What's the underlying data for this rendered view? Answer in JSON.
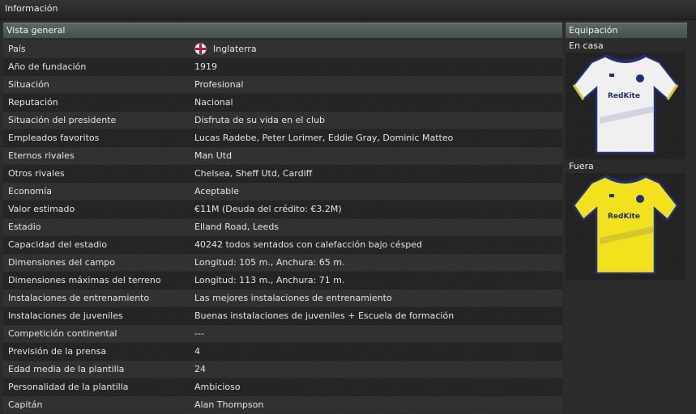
{
  "window": {
    "title": "Información"
  },
  "overview": {
    "header": "Vista general",
    "rows": [
      {
        "label": "País",
        "value": "Inglaterra"
      },
      {
        "label": "Año de fundación",
        "value": "1919"
      },
      {
        "label": "Situación",
        "value": "Profesional"
      },
      {
        "label": "Reputación",
        "value": "Nacional"
      },
      {
        "label": "Situación del presidente",
        "value": "Disfruta de su vida en el club"
      },
      {
        "label": "Empleados favoritos",
        "value": "Lucas Radebe, Peter Lorimer, Eddie Gray, Dominic Matteo"
      },
      {
        "label": "Eternos rivales",
        "value": "Man Utd"
      },
      {
        "label": "Otros rivales",
        "value": "Chelsea, Sheff Utd, Cardiff"
      },
      {
        "label": "Economía",
        "value": "Aceptable"
      },
      {
        "label": "Valor estimado",
        "value": "€11M (Deuda del crédito: €3.2M)"
      },
      {
        "label": "Estadio",
        "value": "Elland Road, Leeds"
      },
      {
        "label": "Capacidad del estadio",
        "value": "40242 todos sentados con calefacción bajo césped"
      },
      {
        "label": "Dimensiones del campo",
        "value": "Longitud: 105 m., Anchura: 65 m."
      },
      {
        "label": "Dimensiones máximas del terreno",
        "value": "Longitud: 113 m., Anchura: 71 m."
      },
      {
        "label": "Instalaciones de entrenamiento",
        "value": "Las mejores instalaciones de entrenamiento"
      },
      {
        "label": "Instalaciones de juveniles",
        "value": "Buenas instalaciones de juveniles + Escuela de formación"
      },
      {
        "label": "Competición continental",
        "value": "---"
      },
      {
        "label": "Previsión de la prensa",
        "value": "4"
      },
      {
        "label": "Edad media de la plantilla",
        "value": "24"
      },
      {
        "label": "Personalidad de la plantilla",
        "value": "Ambicioso"
      },
      {
        "label": "Capitán",
        "value": "Alan Thompson"
      }
    ]
  },
  "kits": {
    "header": "Equipación",
    "home": {
      "label": "En casa",
      "sponsor": "RedKite",
      "color": "#f0f0f0",
      "trim": "#1f2f7a"
    },
    "away": {
      "label": "Fuera",
      "sponsor": "RedKite",
      "color": "#f2e21e",
      "trim": "#1f2f7a"
    }
  },
  "icons": {
    "country_flag": "england-flag-icon"
  }
}
